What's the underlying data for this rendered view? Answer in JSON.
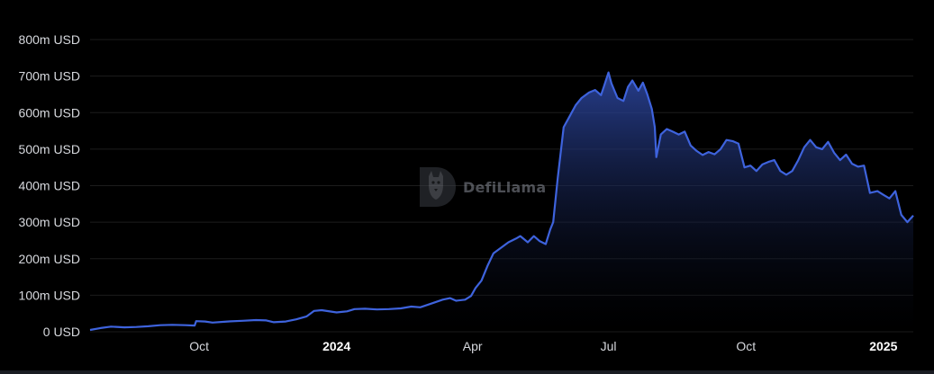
{
  "watermark": {
    "text": "DefiLlama",
    "icon": "llama-logo-icon"
  },
  "colors": {
    "background": "#000000",
    "line": "#3e63dd",
    "area_top": "#2f4aa8",
    "area_bottom": "#000000",
    "grid": "#1c1c1c",
    "axis_text": "#d6d8dd"
  },
  "chart_data": {
    "type": "area",
    "title": "",
    "xlabel": "",
    "ylabel": "",
    "ylim": [
      0,
      800
    ],
    "y_unit": "m USD",
    "grid": true,
    "legend": "none",
    "x_ticks": [
      {
        "label": "Oct",
        "date": "2023-10-01",
        "bold": false
      },
      {
        "label": "2024",
        "date": "2024-01-01",
        "bold": true
      },
      {
        "label": "Apr",
        "date": "2024-04-01",
        "bold": false
      },
      {
        "label": "Jul",
        "date": "2024-07-01",
        "bold": false
      },
      {
        "label": "Oct",
        "date": "2024-10-01",
        "bold": false
      },
      {
        "label": "2025",
        "date": "2025-01-01",
        "bold": true
      }
    ],
    "y_ticks": [
      {
        "label": "0 USD",
        "value": 0
      },
      {
        "label": "100m USD",
        "value": 100
      },
      {
        "label": "200m USD",
        "value": 200
      },
      {
        "label": "300m USD",
        "value": 300
      },
      {
        "label": "400m USD",
        "value": 400
      },
      {
        "label": "500m USD",
        "value": 500
      },
      {
        "label": "600m USD",
        "value": 600
      },
      {
        "label": "700m USD",
        "value": 700
      },
      {
        "label": "800m USD",
        "value": 800
      }
    ],
    "series": [
      {
        "points": [
          [
            "2023-07-20",
            5
          ],
          [
            "2023-07-27",
            10
          ],
          [
            "2023-08-03",
            14
          ],
          [
            "2023-08-12",
            12
          ],
          [
            "2023-08-20",
            13
          ],
          [
            "2023-08-28",
            15
          ],
          [
            "2023-09-05",
            18
          ],
          [
            "2023-09-13",
            19
          ],
          [
            "2023-09-22",
            18
          ],
          [
            "2023-09-28",
            17
          ],
          [
            "2023-09-29",
            29
          ],
          [
            "2023-10-05",
            28
          ],
          [
            "2023-10-10",
            25
          ],
          [
            "2023-10-20",
            28
          ],
          [
            "2023-10-30",
            30
          ],
          [
            "2023-11-08",
            32
          ],
          [
            "2023-11-15",
            31
          ],
          [
            "2023-11-20",
            26
          ],
          [
            "2023-11-28",
            28
          ],
          [
            "2023-12-05",
            34
          ],
          [
            "2023-12-12",
            42
          ],
          [
            "2023-12-17",
            57
          ],
          [
            "2023-12-22",
            59
          ],
          [
            "2024-01-01",
            53
          ],
          [
            "2024-01-08",
            56
          ],
          [
            "2024-01-13",
            62
          ],
          [
            "2024-01-20",
            63
          ],
          [
            "2024-01-28",
            61
          ],
          [
            "2024-02-05",
            62
          ],
          [
            "2024-02-13",
            64
          ],
          [
            "2024-02-20",
            69
          ],
          [
            "2024-02-26",
            67
          ],
          [
            "2024-03-05",
            78
          ],
          [
            "2024-03-12",
            88
          ],
          [
            "2024-03-17",
            92
          ],
          [
            "2024-03-21",
            85
          ],
          [
            "2024-03-27",
            88
          ],
          [
            "2024-03-31",
            98
          ],
          [
            "2024-04-03",
            120
          ],
          [
            "2024-04-07",
            140
          ],
          [
            "2024-04-11",
            180
          ],
          [
            "2024-04-15",
            215
          ],
          [
            "2024-04-20",
            230
          ],
          [
            "2024-04-25",
            245
          ],
          [
            "2024-04-30",
            255
          ],
          [
            "2024-05-03",
            262
          ],
          [
            "2024-05-08",
            245
          ],
          [
            "2024-05-12",
            262
          ],
          [
            "2024-05-16",
            248
          ],
          [
            "2024-05-20",
            240
          ],
          [
            "2024-05-23",
            280
          ],
          [
            "2024-05-25",
            300
          ],
          [
            "2024-05-28",
            420
          ],
          [
            "2024-06-01",
            560
          ],
          [
            "2024-06-05",
            590
          ],
          [
            "2024-06-09",
            620
          ],
          [
            "2024-06-13",
            640
          ],
          [
            "2024-06-18",
            655
          ],
          [
            "2024-06-22",
            662
          ],
          [
            "2024-06-26",
            648
          ],
          [
            "2024-06-28",
            672
          ],
          [
            "2024-07-01",
            710
          ],
          [
            "2024-07-03",
            680
          ],
          [
            "2024-07-07",
            640
          ],
          [
            "2024-07-11",
            632
          ],
          [
            "2024-07-14",
            670
          ],
          [
            "2024-07-17",
            688
          ],
          [
            "2024-07-21",
            660
          ],
          [
            "2024-07-24",
            682
          ],
          [
            "2024-07-27",
            650
          ],
          [
            "2024-07-30",
            610
          ],
          [
            "2024-08-01",
            560
          ],
          [
            "2024-08-02",
            478
          ],
          [
            "2024-08-05",
            540
          ],
          [
            "2024-08-09",
            555
          ],
          [
            "2024-08-13",
            548
          ],
          [
            "2024-08-17",
            540
          ],
          [
            "2024-08-21",
            548
          ],
          [
            "2024-08-25",
            510
          ],
          [
            "2024-08-29",
            495
          ],
          [
            "2024-09-02",
            484
          ],
          [
            "2024-09-06",
            492
          ],
          [
            "2024-09-10",
            486
          ],
          [
            "2024-09-14",
            500
          ],
          [
            "2024-09-18",
            525
          ],
          [
            "2024-09-22",
            522
          ],
          [
            "2024-09-26",
            515
          ],
          [
            "2024-09-30",
            450
          ],
          [
            "2024-10-04",
            455
          ],
          [
            "2024-10-08",
            440
          ],
          [
            "2024-10-12",
            458
          ],
          [
            "2024-10-16",
            465
          ],
          [
            "2024-10-20",
            470
          ],
          [
            "2024-10-24",
            440
          ],
          [
            "2024-10-28",
            430
          ],
          [
            "2024-11-01",
            440
          ],
          [
            "2024-11-05",
            470
          ],
          [
            "2024-11-09",
            505
          ],
          [
            "2024-11-13",
            525
          ],
          [
            "2024-11-17",
            505
          ],
          [
            "2024-11-21",
            500
          ],
          [
            "2024-11-25",
            520
          ],
          [
            "2024-11-29",
            490
          ],
          [
            "2024-12-03",
            470
          ],
          [
            "2024-12-07",
            485
          ],
          [
            "2024-12-11",
            460
          ],
          [
            "2024-12-15",
            452
          ],
          [
            "2024-12-19",
            455
          ],
          [
            "2024-12-23",
            380
          ],
          [
            "2024-12-28",
            385
          ],
          [
            "2025-01-01",
            375
          ],
          [
            "2025-01-05",
            365
          ],
          [
            "2025-01-09",
            385
          ],
          [
            "2025-01-13",
            320
          ],
          [
            "2025-01-17",
            300
          ],
          [
            "2025-01-21",
            318
          ]
        ]
      }
    ]
  }
}
